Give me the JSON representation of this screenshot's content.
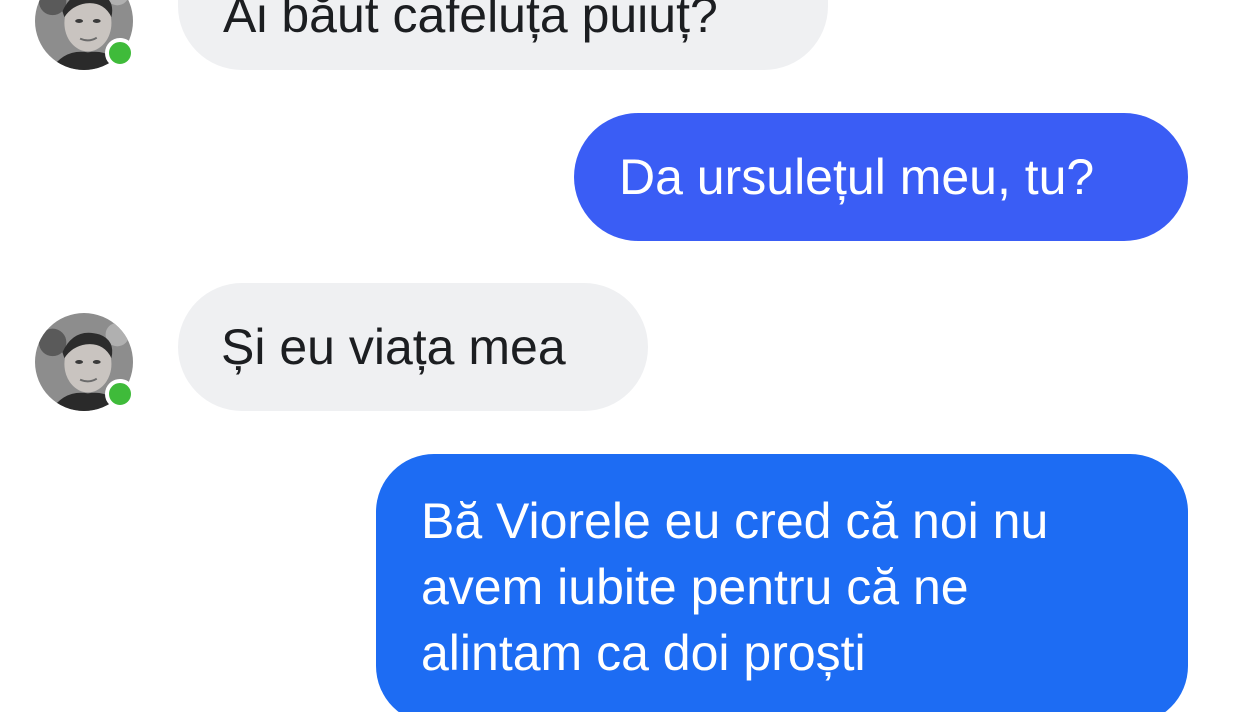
{
  "conversation": {
    "messages": [
      {
        "sender": "contact",
        "text": "Ai băut cafeluța puiuț?"
      },
      {
        "sender": "me",
        "text": "Da ursulețul meu, tu?"
      },
      {
        "sender": "contact",
        "text": "Și eu viața mea"
      },
      {
        "sender": "me",
        "lines": [
          "Bă Viorele eu cred că noi nu",
          "avem iubite pentru că ne",
          "alintam ca doi proști"
        ]
      }
    ]
  },
  "colors": {
    "incoming_bubble": "#eff0f2",
    "outgoing_bubble_1": "#3a5df5",
    "outgoing_bubble_2": "#1d6cf3",
    "online_indicator": "#3fbb3a"
  },
  "icons": {
    "avatar": "contact-avatar",
    "presence": "online-status-dot"
  }
}
